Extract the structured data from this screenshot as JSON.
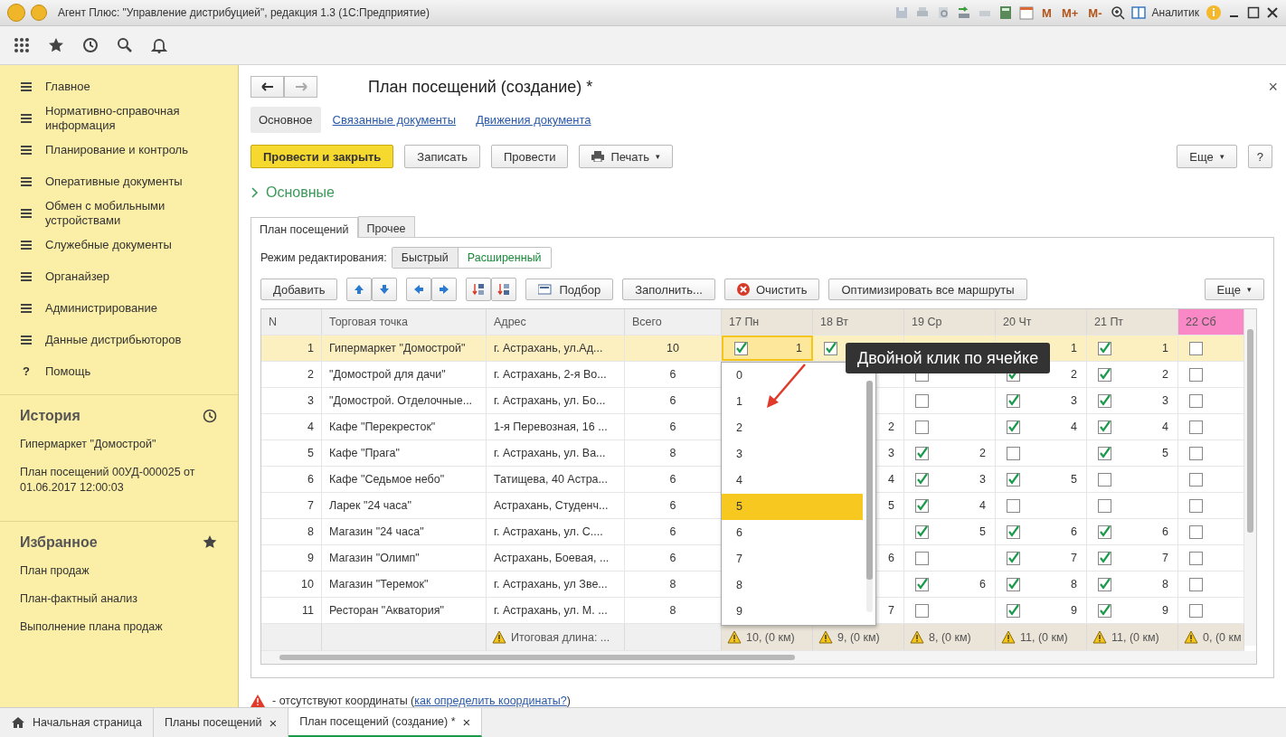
{
  "window": {
    "title": "Агент Плюс: \"Управление дистрибуцией\", редакция 1.3  (1С:Предприятие)",
    "memory_buttons": [
      "M",
      "M+",
      "M-"
    ],
    "user": "Аналитик"
  },
  "sidebar": {
    "items": [
      {
        "label": "Главное"
      },
      {
        "label": "Нормативно-справочная информация"
      },
      {
        "label": "Планирование и контроль"
      },
      {
        "label": "Оперативные документы"
      },
      {
        "label": "Обмен с мобильными устройствами"
      },
      {
        "label": "Служебные документы"
      },
      {
        "label": "Органайзер"
      },
      {
        "label": "Администрирование"
      },
      {
        "label": "Данные дистрибьюторов"
      },
      {
        "label": "Помощь",
        "glyph": "?"
      }
    ],
    "history": {
      "title": "История",
      "items": [
        "Гипермаркет \"Домострой\"",
        "План посещений 00УД-000025 от 01.06.2017 12:00:03"
      ]
    },
    "favorites": {
      "title": "Избранное",
      "items": [
        "План продаж",
        "План-фактный анализ",
        "Выполнение плана продаж"
      ]
    }
  },
  "form": {
    "title": "План посещений  (создание) *",
    "nav_tabs": [
      {
        "label": "Основное",
        "selected": true
      },
      {
        "label": "Связанные документы",
        "selected": false
      },
      {
        "label": "Движения документа",
        "selected": false
      }
    ],
    "buttons": [
      {
        "label": "Провести и закрыть",
        "kind": "primary"
      },
      {
        "label": "Записать",
        "kind": "plain"
      },
      {
        "label": "Провести",
        "kind": "plain"
      },
      {
        "label": "Печать",
        "kind": "print"
      }
    ],
    "more": "Еще",
    "caret": "▾",
    "help": "?",
    "section": "Основные",
    "tabs": [
      {
        "label": "План посещений",
        "selected": true
      },
      {
        "label": "Прочее",
        "selected": false
      }
    ],
    "edit_mode": {
      "label": "Режим редактирования:",
      "options": [
        {
          "label": "Быстрый",
          "selected": true
        },
        {
          "label": "Расширенный",
          "selected": false
        }
      ]
    },
    "table_toolbar": [
      {
        "label": "Добавить",
        "kind": "text"
      },
      {
        "kind": "updown"
      },
      {
        "kind": "leftright"
      },
      {
        "kind": "sort"
      },
      {
        "label": "Подбор",
        "kind": "pick"
      },
      {
        "label": "Заполнить...",
        "kind": "text"
      },
      {
        "label": "Очистить",
        "kind": "clear"
      },
      {
        "label": "Оптимизировать все маршруты",
        "kind": "text"
      }
    ],
    "table_more": "Еще",
    "table": {
      "columns": [
        "N",
        "Торговая точка",
        "Адрес",
        "Всего"
      ],
      "days": [
        {
          "label": "17 Пн",
          "weekend": false
        },
        {
          "label": "18 Вт",
          "weekend": false
        },
        {
          "label": "19 Ср",
          "weekend": false
        },
        {
          "label": "20 Чт",
          "weekend": false
        },
        {
          "label": "21 Пт",
          "weekend": false
        },
        {
          "label": "22 Сб",
          "weekend": true
        }
      ],
      "rows": [
        {
          "n": "1",
          "name": "Гипермаркет \"Домострой\"",
          "address": "г. Астрахань, ул.Ад...",
          "total": "10",
          "selected": true,
          "days": {
            "mon": {
              "checked": true,
              "value": "1",
              "editing": true
            },
            "tue": {
              "checked": true
            },
            "thu": {
              "value": "1"
            },
            "fri": {
              "checked": true,
              "value": "1"
            },
            "sat": {
              "checked": false
            }
          }
        },
        {
          "n": "2",
          "name": "\"Домострой для дачи\"",
          "address": "г. Астрахань, 2-я Во...",
          "total": "6",
          "selected": false,
          "days": {
            "wed": {
              "checked": false
            },
            "thu": {
              "checked": true,
              "value": "2"
            },
            "fri": {
              "checked": true,
              "value": "2"
            },
            "sat": {
              "checked": false
            }
          }
        },
        {
          "n": "3",
          "name": "\"Домострой. Отделочные...",
          "address": "г. Астрахань, ул. Бо...",
          "total": "6",
          "selected": false,
          "days": {
            "wed": {
              "checked": false
            },
            "thu": {
              "checked": true,
              "value": "3"
            },
            "fri": {
              "checked": true,
              "value": "3"
            },
            "sat": {
              "checked": false
            }
          }
        },
        {
          "n": "4",
          "name": "Кафе \"Перекресток\"",
          "address": "1-я Перевозная, 16 ...",
          "total": "6",
          "selected": false,
          "days": {
            "tue": {
              "value": "2"
            },
            "wed": {
              "checked": false
            },
            "thu": {
              "checked": true,
              "value": "4"
            },
            "fri": {
              "checked": true,
              "value": "4"
            },
            "sat": {
              "checked": false
            }
          }
        },
        {
          "n": "5",
          "name": "Кафе \"Прага\"",
          "address": "г. Астрахань, ул. Ва...",
          "total": "8",
          "selected": false,
          "days": {
            "tue": {
              "value": "3"
            },
            "wed": {
              "checked": true,
              "value": "2"
            },
            "thu": {
              "checked": false
            },
            "fri": {
              "checked": true,
              "value": "5"
            },
            "sat": {
              "checked": false
            }
          }
        },
        {
          "n": "6",
          "name": "Кафе \"Седьмое небо\"",
          "address": "Татищева, 40 Астра...",
          "total": "6",
          "selected": false,
          "days": {
            "tue": {
              "value": "4"
            },
            "wed": {
              "checked": true,
              "value": "3"
            },
            "thu": {
              "checked": true,
              "value": "5"
            },
            "fri": {
              "checked": false
            },
            "sat": {
              "checked": false
            }
          }
        },
        {
          "n": "7",
          "name": "Ларек \"24 часа\"",
          "address": "Астрахань, Студенч...",
          "total": "6",
          "selected": false,
          "days": {
            "tue": {
              "value": "5"
            },
            "wed": {
              "checked": true,
              "value": "4"
            },
            "thu": {
              "checked": false
            },
            "fri": {
              "checked": false
            },
            "sat": {
              "checked": false
            }
          }
        },
        {
          "n": "8",
          "name": "Магазин \"24 часа\"",
          "address": "г. Астрахань, ул. С....",
          "total": "6",
          "selected": false,
          "days": {
            "wed": {
              "checked": true,
              "value": "5"
            },
            "thu": {
              "checked": true,
              "value": "6"
            },
            "fri": {
              "checked": true,
              "value": "6"
            },
            "sat": {
              "checked": false
            }
          }
        },
        {
          "n": "9",
          "name": "Магазин \"Олимп\"",
          "address": "Астрахань, Боевая, ...",
          "total": "6",
          "selected": false,
          "days": {
            "tue": {
              "value": "6"
            },
            "wed": {
              "checked": false
            },
            "thu": {
              "checked": true,
              "value": "7"
            },
            "fri": {
              "checked": true,
              "value": "7"
            },
            "sat": {
              "checked": false
            }
          }
        },
        {
          "n": "10",
          "name": "Магазин \"Теремок\"",
          "address": "г. Астрахань, ул Зве...",
          "total": "8",
          "selected": false,
          "days": {
            "wed": {
              "checked": true,
              "value": "6"
            },
            "thu": {
              "checked": true,
              "value": "8"
            },
            "fri": {
              "checked": true,
              "value": "8"
            },
            "sat": {
              "checked": false
            }
          }
        },
        {
          "n": "11",
          "name": "Ресторан \"Акватория\"",
          "address": "г. Астрахань, ул. М. ...",
          "total": "8",
          "selected": false,
          "days": {
            "tue": {
              "value": "7"
            },
            "wed": {
              "checked": false
            },
            "thu": {
              "checked": true,
              "value": "9"
            },
            "fri": {
              "checked": true,
              "value": "9"
            },
            "sat": {
              "checked": false
            }
          }
        }
      ],
      "footer": {
        "address": "Итоговая длина: ...",
        "days": [
          "10, (0 км)",
          "9, (0 км)",
          "8, (0 км)",
          "11, (0 км)",
          "11, (0 км)",
          "0, (0 км"
        ]
      }
    },
    "dropdown": [
      {
        "label": "0",
        "selected": false
      },
      {
        "label": "1",
        "selected": false
      },
      {
        "label": "2",
        "selected": false
      },
      {
        "label": "3",
        "selected": false
      },
      {
        "label": "4",
        "selected": false
      },
      {
        "label": "5",
        "selected": true
      },
      {
        "label": "6",
        "selected": false
      },
      {
        "label": "7",
        "selected": false
      },
      {
        "label": "8",
        "selected": false
      },
      {
        "label": "9",
        "selected": false
      }
    ],
    "tooltip": "Двойной клик по ячейке",
    "note": {
      "text": "- отсутствуют координаты (",
      "link": "как определить координаты?",
      "end": ")"
    }
  },
  "taskbar": [
    {
      "label": "Начальная страница",
      "kind": "home",
      "selected": false
    },
    {
      "label": "Планы посещений",
      "kind": "doc",
      "selected": false
    },
    {
      "label": "План посещений  (создание) *",
      "kind": "doc",
      "selected": true
    }
  ],
  "close_glyph": "×"
}
